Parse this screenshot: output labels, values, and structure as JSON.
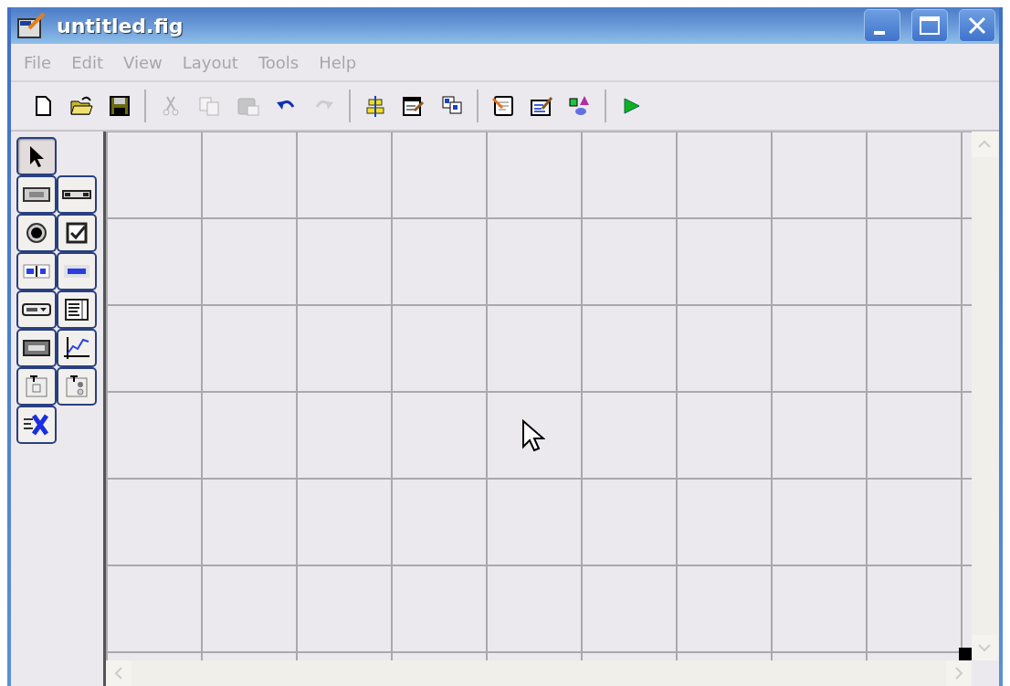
{
  "window": {
    "title": "untitled.fig"
  },
  "menu": [
    {
      "label": "File",
      "disabled": true
    },
    {
      "label": "Edit",
      "disabled": true
    },
    {
      "label": "View",
      "disabled": true
    },
    {
      "label": "Layout",
      "disabled": true
    },
    {
      "label": "Tools",
      "disabled": true
    },
    {
      "label": "Help",
      "disabled": true
    }
  ],
  "toolbar": [
    [
      {
        "kind": "new",
        "disabled": false
      },
      {
        "kind": "open",
        "disabled": false
      },
      {
        "kind": "save",
        "disabled": false
      }
    ],
    [
      {
        "kind": "cut",
        "disabled": true
      },
      {
        "kind": "copy",
        "disabled": true
      },
      {
        "kind": "paste",
        "disabled": true
      },
      {
        "kind": "undo",
        "disabled": false
      },
      {
        "kind": "redo",
        "disabled": true
      }
    ],
    [
      {
        "kind": "align",
        "disabled": false
      },
      {
        "kind": "menu-editor",
        "disabled": false
      },
      {
        "kind": "tab-order",
        "disabled": false
      }
    ],
    [
      {
        "kind": "editor",
        "disabled": false
      },
      {
        "kind": "inspector",
        "disabled": false
      },
      {
        "kind": "browser",
        "disabled": false
      }
    ],
    [
      {
        "kind": "run",
        "disabled": false
      }
    ]
  ],
  "palette": [
    {
      "kind": "select",
      "selected": true
    },
    {
      "kind": "push-button",
      "selected": false
    },
    {
      "kind": "slider",
      "selected": false
    },
    {
      "kind": "radio",
      "selected": false
    },
    {
      "kind": "checkbox",
      "selected": false
    },
    {
      "kind": "edit-text",
      "selected": false
    },
    {
      "kind": "static-text",
      "selected": false
    },
    {
      "kind": "popup",
      "selected": false
    },
    {
      "kind": "listbox",
      "selected": false
    },
    {
      "kind": "toggle",
      "selected": false
    },
    {
      "kind": "axes",
      "selected": false
    },
    {
      "kind": "panel",
      "selected": false
    },
    {
      "kind": "button-group",
      "selected": false
    },
    {
      "kind": "activex",
      "selected": false
    }
  ]
}
